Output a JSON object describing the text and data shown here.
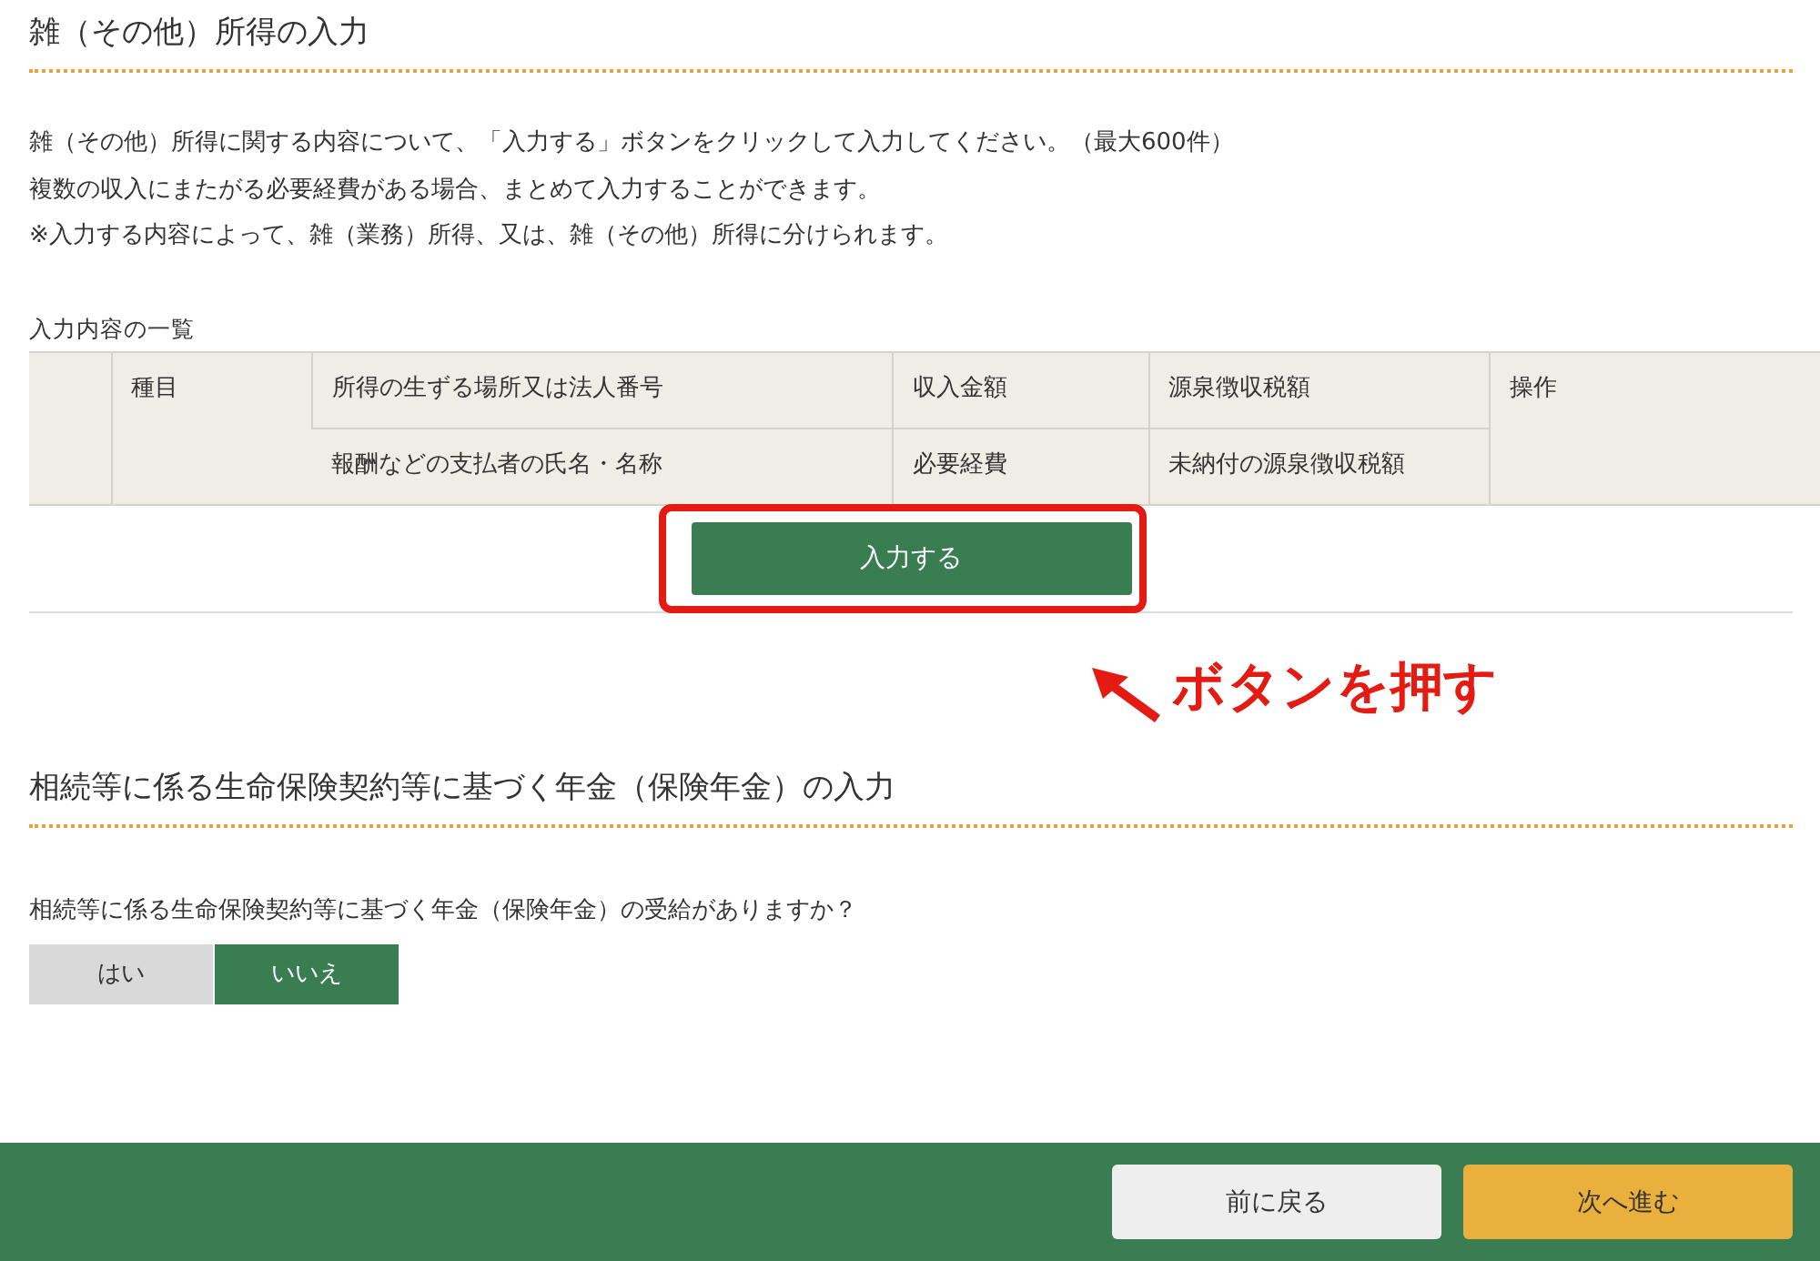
{
  "section_1": {
    "title": "雑（その他）所得の入力",
    "intro": [
      "雑（その他）所得に関する内容について、「入力する」ボタンをクリックして入力してください。（最大600件）",
      "複数の収入にまたがる必要経費がある場合、まとめて入力することができます。",
      "※入力する内容によって、雑（業務）所得、又は、雑（その他）所得に分けられます。"
    ],
    "table": {
      "caption": "入力内容の一覧",
      "columns": [
        {
          "top": "種目"
        },
        {
          "top": "所得の生ずる場所又は法人番号",
          "bottom": "報酬などの支払者の氏名・名称"
        },
        {
          "top": "収入金額",
          "bottom": "必要経費"
        },
        {
          "top": "源泉徴収税額",
          "bottom": "未納付の源泉徴収税額"
        },
        {
          "top": "操作"
        }
      ]
    },
    "input_button": "入力する",
    "annotation": "ボタンを押す"
  },
  "section_2": {
    "title": "相続等に係る生命保険契約等に基づく年金（保険年金）の入力",
    "question": "相続等に係る生命保険契約等に基づく年金（保険年金）の受給がありますか？",
    "options": [
      {
        "label": "はい",
        "selected": false
      },
      {
        "label": "いいえ",
        "selected": true
      }
    ]
  },
  "footer": [
    {
      "label": "前に戻る",
      "kind": "back"
    },
    {
      "label": "次へ進む",
      "kind": "next"
    }
  ]
}
